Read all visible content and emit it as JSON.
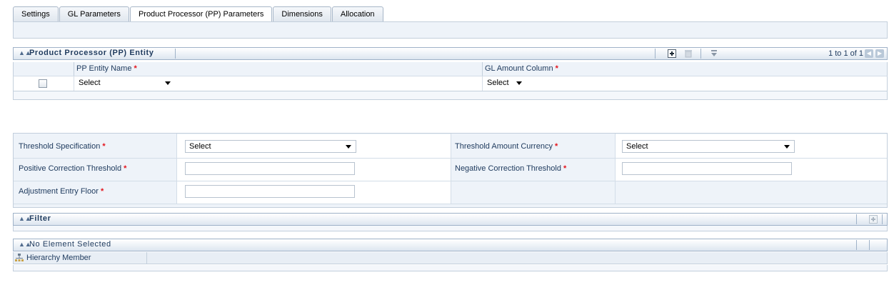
{
  "tabs": [
    {
      "label": "Settings",
      "active": false
    },
    {
      "label": "GL Parameters",
      "active": false
    },
    {
      "label": "Product Processor (PP) Parameters",
      "active": true
    },
    {
      "label": "Dimensions",
      "active": false
    },
    {
      "label": "Allocation",
      "active": false
    }
  ],
  "pp_entity": {
    "title": "Product Processor (PP) Entity",
    "pager": "1 to 1 of 1",
    "columns": {
      "entity_name": "PP Entity Name",
      "gl_amount": "GL Amount Column"
    },
    "row": {
      "entity_value": "Select",
      "gl_amount_value": "Select"
    },
    "icons": [
      "add-icon",
      "delete-icon",
      "filter-icon",
      "prev-page-icon",
      "next-page-icon"
    ]
  },
  "threshold": {
    "spec_label": "Threshold Specification",
    "spec_value": "Select",
    "currency_label": "Threshold Amount Currency",
    "currency_value": "Select",
    "pos_label": "Positive Correction Threshold",
    "pos_value": "",
    "neg_label": "Negative Correction Threshold",
    "neg_value": "",
    "floor_label": "Adjustment Entry Floor",
    "floor_value": "",
    "required_mark": "*"
  },
  "filter": {
    "title": "Filter"
  },
  "no_element": {
    "title": "No Element Selected",
    "hierarchy_label": "Hierarchy Member"
  },
  "colors": {
    "required": "#e3141c",
    "header_text": "#203c5f",
    "panel_bg": "#eef3f9"
  }
}
